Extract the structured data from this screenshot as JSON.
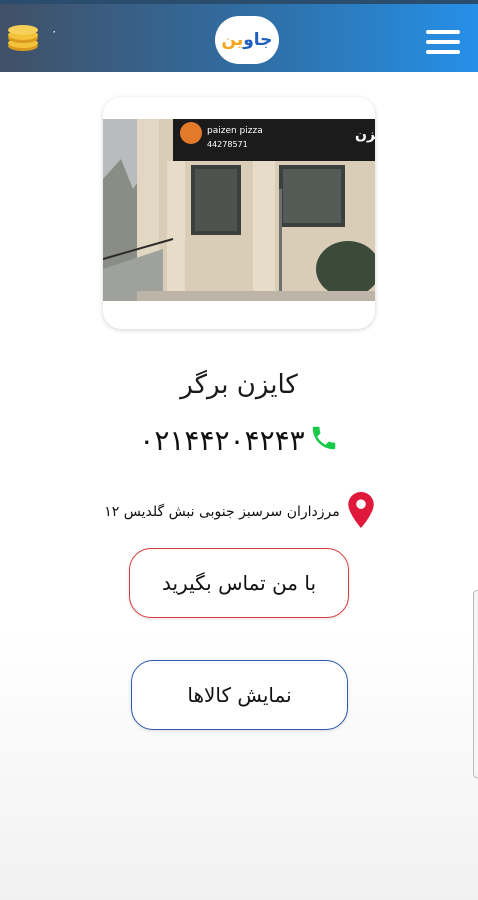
{
  "header": {
    "coins_icon": "coins-icon",
    "coin_count": "۰",
    "logo_text_main": "جاو",
    "logo_text_accent": "ین",
    "menu_icon": "hamburger-menu-icon"
  },
  "shop": {
    "photo_sign_en": "paizen pizza",
    "photo_sign_phone": "44278571",
    "photo_sign_fa": "کایزن",
    "name": "کایزن برگر",
    "phone": "۰۲۱۴۴۲۰۴۲۴۳",
    "phone_icon": "phone-icon",
    "address": "مرزداران سرسبز جنوبی نبش گلدیس ۱۲",
    "address_icon": "location-pin-icon"
  },
  "actions": {
    "contact_label": "با من تماس بگیرید",
    "products_label": "نمایش کالاها"
  },
  "colors": {
    "header_start": "#415066",
    "header_end": "#2690e8",
    "contact_border": "#d83a3a",
    "products_border": "#2c5aa8",
    "phone_icon": "#19c94a",
    "pin": "#e0183a"
  }
}
